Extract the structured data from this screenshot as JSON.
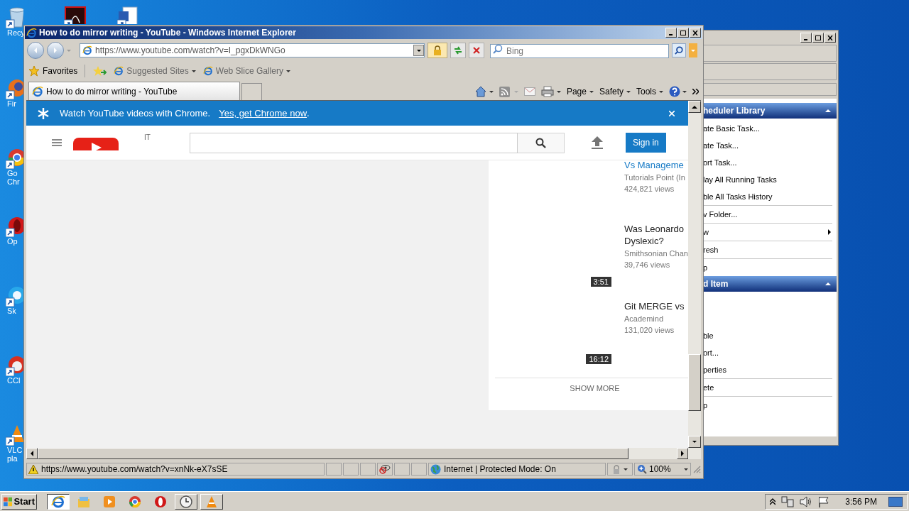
{
  "desktop_icons": [
    {
      "kind": "bin",
      "lines": [
        "Recy"
      ]
    },
    {
      "kind": "pdf"
    },
    {
      "kind": "doc"
    },
    {
      "kind": "firefox",
      "lines": [
        "Fir"
      ]
    },
    {
      "kind": "chrome",
      "lines": [
        "Go",
        "Chr"
      ]
    },
    {
      "kind": "opera",
      "lines": [
        "Op"
      ]
    },
    {
      "kind": "skype",
      "lines": [
        "Sk"
      ]
    },
    {
      "kind": "ccleaner",
      "lines": [
        "CCl"
      ]
    },
    {
      "kind": "vlc",
      "lines": [
        "VLC",
        "pla"
      ]
    }
  ],
  "back_window": {
    "actions": [
      {
        "kind": "header",
        "label": "heduler Library"
      },
      {
        "kind": "item",
        "label": "ate Basic Task..."
      },
      {
        "kind": "item",
        "label": "ate Task..."
      },
      {
        "kind": "item",
        "label": "ort Task..."
      },
      {
        "kind": "item",
        "label": "lay All Running Tasks"
      },
      {
        "kind": "item",
        "label": "ble All Tasks History"
      },
      {
        "kind": "divider"
      },
      {
        "kind": "item",
        "label": "v Folder..."
      },
      {
        "kind": "divider"
      },
      {
        "kind": "submenu",
        "label": "w"
      },
      {
        "kind": "divider"
      },
      {
        "kind": "item",
        "label": "resh"
      },
      {
        "kind": "divider"
      },
      {
        "kind": "item",
        "label": "p"
      },
      {
        "kind": "header",
        "label": "d Item"
      },
      {
        "kind": "blank"
      },
      {
        "kind": "blank"
      },
      {
        "kind": "item",
        "label": "ble"
      },
      {
        "kind": "item",
        "label": "ort..."
      },
      {
        "kind": "item",
        "label": "perties"
      },
      {
        "kind": "divider"
      },
      {
        "kind": "item",
        "label": "ete"
      },
      {
        "kind": "divider"
      },
      {
        "kind": "item",
        "label": "p"
      }
    ]
  },
  "ie": {
    "title": "How to do mirror writing - YouTube - Windows Internet Explorer",
    "address": "https://www.youtube.com/watch?v=I_pgxDkWNGo",
    "search_placeholder": "Bing",
    "favorites": {
      "label": "Favorites",
      "links": [
        "Suggested Sites",
        "Web Slice Gallery"
      ]
    },
    "tabs": [
      {
        "label": "How to do mirror writing - YouTube",
        "selected": true
      }
    ],
    "commands": [
      "Page",
      "Safety",
      "Tools"
    ],
    "status_url": "https://www.youtube.com/watch?v=xnNk-eX7sSE",
    "zone": "Internet | Protected Mode: On",
    "zoom": "100%"
  },
  "youtube": {
    "banner": {
      "text": "Watch YouTube videos with Chrome.",
      "link": "Yes, get Chrome now",
      "after": "."
    },
    "logo_region": "IT",
    "sign_in": "Sign in",
    "videos": [
      {
        "title_lines": [
          "Vs Manageme"
        ],
        "highlighted": true,
        "channel": "Tutorials Point (In",
        "views": "424,821 views"
      },
      {
        "title_lines": [
          "Was Leonardo",
          "Dyslexic?"
        ],
        "highlighted": false,
        "channel": "Smithsonian Chan",
        "views": "39,746 views",
        "duration": "3:51"
      },
      {
        "title_lines": [
          "Git MERGE vs"
        ],
        "highlighted": false,
        "channel": "Academind",
        "views": "131,020 views",
        "duration": "16:12"
      }
    ],
    "show_more": "SHOW MORE"
  },
  "taskbar": {
    "start": "Start",
    "apps": [
      {
        "kind": "ie",
        "selected": true,
        "running": true
      },
      {
        "kind": "explorer",
        "selected": false,
        "running": false
      },
      {
        "kind": "media",
        "selected": false,
        "running": false
      },
      {
        "kind": "chrome",
        "selected": false,
        "running": false
      },
      {
        "kind": "opera",
        "selected": false,
        "running": false
      },
      {
        "kind": "clock",
        "selected": false,
        "running": true
      },
      {
        "kind": "vlc",
        "selected": false,
        "running": true
      }
    ],
    "clock": "3:56 PM"
  }
}
